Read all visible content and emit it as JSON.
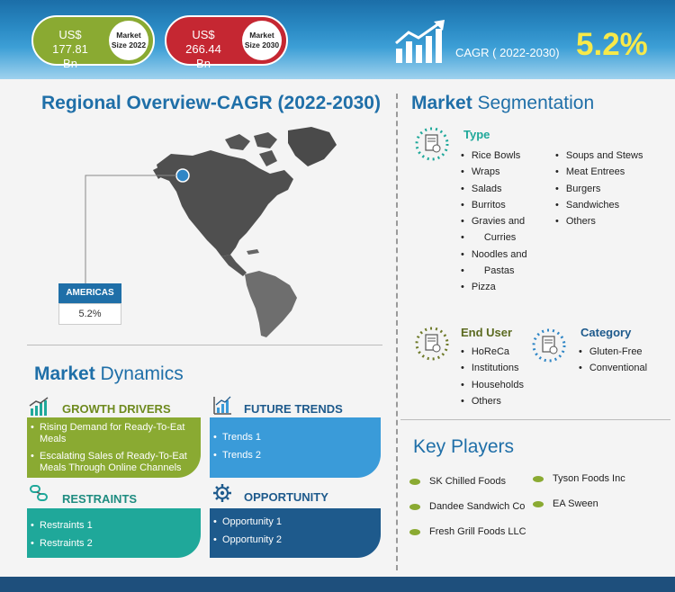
{
  "header": {
    "size_2022": {
      "value_line1": "US$ 177.81",
      "value_line2": "Bn",
      "label_line1": "Market",
      "label_line2": "Size 2022"
    },
    "size_2030": {
      "value_line1": "US$ 266.44",
      "value_line2": "Bn",
      "label_line1": "Market",
      "label_line2": "Size 2030"
    },
    "cagr_label": "CAGR ( 2022-2030)",
    "cagr_value": "5.2%"
  },
  "regional": {
    "title": "Regional Overview-CAGR (2022-2030)",
    "region_label": "AMERICAS",
    "region_value": "5.2%"
  },
  "segmentation": {
    "title_bold": "Market",
    "title_rest": " Segmentation",
    "type": {
      "heading": "Type",
      "col1": [
        "Rice Bowls",
        "Wraps",
        "Salads",
        "Burritos",
        "Gravies and",
        "Curries",
        "Noodles and",
        "Pastas",
        "Pizza"
      ],
      "col2": [
        "Soups and Stews",
        "Meat Entrees",
        "Burgers",
        "Sandwiches",
        "Others"
      ]
    },
    "end_user": {
      "heading": "End User",
      "items": [
        "HoReCa",
        "Institutions",
        "Households",
        "Others"
      ]
    },
    "category": {
      "heading": "Category",
      "items": [
        "Gluten-Free",
        "Conventional"
      ]
    }
  },
  "dynamics": {
    "title_bold": "Market",
    "title_rest": " Dynamics",
    "growth_drivers": {
      "heading": "GROWTH DRIVERS",
      "items": [
        "Rising  Demand for Ready-To-Eat Meals",
        "Escalating Sales of Ready-To-Eat Meals Through Online Channels"
      ]
    },
    "future_trends": {
      "heading": "FUTURE TRENDS",
      "items": [
        "Trends 1",
        "Trends 2"
      ]
    },
    "restraints": {
      "heading": "RESTRAINTS",
      "items": [
        "Restraints 1",
        "Restraints 2"
      ]
    },
    "opportunity": {
      "heading": "OPPORTUNITY",
      "items": [
        "Opportunity 1",
        "Opportunity 2"
      ]
    }
  },
  "key_players": {
    "title": "Key Players",
    "col1": [
      "SK Chilled Foods",
      "Dandee Sandwich Co",
      "Fresh Grill Foods LLC"
    ],
    "col2": [
      "Tyson Foods Inc",
      "EA Sween"
    ]
  },
  "colors": {
    "header_blue": "#1b6ea8",
    "green": "#8aaa32",
    "red": "#c52732",
    "teal": "#1fa89a",
    "light_blue": "#3a9bd9",
    "navy": "#1e5a8c",
    "cagr_yellow": "#f7e94a"
  },
  "icons": {
    "cagr": "growth-chart-icon",
    "type": "document-chart-icon",
    "growth_drivers": "bar-growth-icon",
    "future_trends": "trend-chart-icon",
    "restraints": "restraint-chain-icon",
    "opportunity": "gear-opportunity-icon"
  }
}
